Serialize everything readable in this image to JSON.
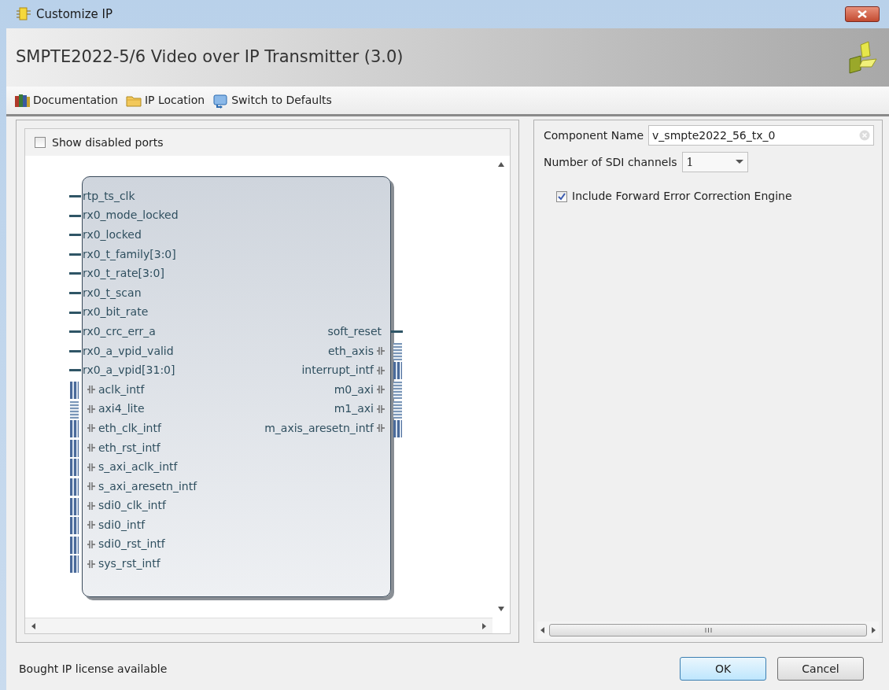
{
  "window": {
    "title": "Customize IP"
  },
  "header": {
    "title": "SMPTE2022-5/6 Video over IP Transmitter (3.0)"
  },
  "toolbar": [
    {
      "label": "Documentation"
    },
    {
      "label": "IP Location"
    },
    {
      "label": "Switch to Defaults"
    }
  ],
  "show_disabled_ports": {
    "label": "Show disabled ports",
    "checked": false
  },
  "block": {
    "left_ports": [
      {
        "name": "rtp_ts_clk",
        "kind": "wire"
      },
      {
        "name": "rx0_mode_locked",
        "kind": "wire"
      },
      {
        "name": "rx0_locked",
        "kind": "wire"
      },
      {
        "name": "rx0_t_family[3:0]",
        "kind": "wire"
      },
      {
        "name": "rx0_t_rate[3:0]",
        "kind": "wire"
      },
      {
        "name": "rx0_t_scan",
        "kind": "wire"
      },
      {
        "name": "rx0_bit_rate",
        "kind": "wire"
      },
      {
        "name": "rx0_crc_err_a",
        "kind": "wire"
      },
      {
        "name": "rx0_a_vpid_valid",
        "kind": "wire"
      },
      {
        "name": "rx0_a_vpid[31:0]",
        "kind": "wire"
      },
      {
        "name": "aclk_intf",
        "kind": "interface"
      },
      {
        "name": "axi4_lite",
        "kind": "bus"
      },
      {
        "name": "eth_clk_intf",
        "kind": "interface"
      },
      {
        "name": "eth_rst_intf",
        "kind": "interface"
      },
      {
        "name": "s_axi_aclk_intf",
        "kind": "interface"
      },
      {
        "name": "s_axi_aresetn_intf",
        "kind": "interface"
      },
      {
        "name": "sdi0_clk_intf",
        "kind": "interface"
      },
      {
        "name": "sdi0_intf",
        "kind": "interface"
      },
      {
        "name": "sdi0_rst_intf",
        "kind": "interface"
      },
      {
        "name": "sys_rst_intf",
        "kind": "interface"
      }
    ],
    "right_ports": [
      {
        "name": "soft_reset",
        "kind": "wire"
      },
      {
        "name": "eth_axis",
        "kind": "bus"
      },
      {
        "name": "interrupt_intf",
        "kind": "interface"
      },
      {
        "name": "m0_axi",
        "kind": "bus"
      },
      {
        "name": "m1_axi",
        "kind": "bus"
      },
      {
        "name": "m_axis_aresetn_intf",
        "kind": "interface"
      }
    ]
  },
  "parameters": {
    "component_name": {
      "label": "Component Name",
      "value": "v_smpte2022_56_tx_0"
    },
    "sdi_channels": {
      "label": "Number of SDI channels",
      "value": "1"
    },
    "fec": {
      "label": "Include Forward Error Correction Engine",
      "checked": true
    }
  },
  "status_bar": {
    "text": "Bought IP license available"
  },
  "buttons": [
    {
      "label": "OK",
      "default": true
    },
    {
      "label": "Cancel",
      "default": false
    }
  ]
}
